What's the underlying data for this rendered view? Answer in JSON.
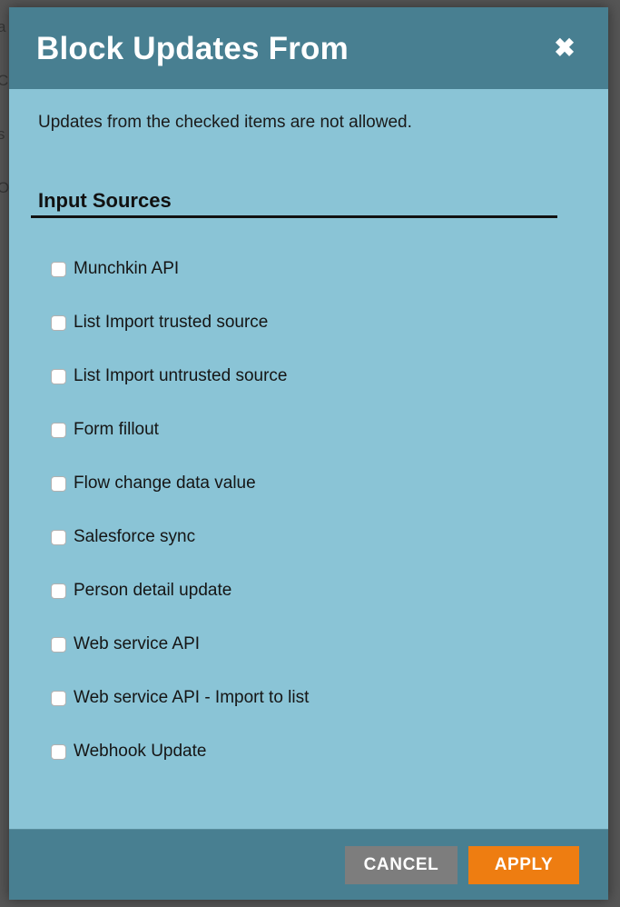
{
  "backdrop": {
    "clipped_glyphs": [
      "a",
      "C",
      "s",
      "O"
    ]
  },
  "dialog": {
    "title": "Block Updates From",
    "close_icon": "close-icon",
    "close_glyph": "✖",
    "description": "Updates from the checked items are not allowed.",
    "section_heading": "Input Sources",
    "items": [
      {
        "label": "Munchkin API",
        "checked": false
      },
      {
        "label": "List Import trusted source",
        "checked": false
      },
      {
        "label": "List Import untrusted source",
        "checked": false
      },
      {
        "label": "Form fillout",
        "checked": false
      },
      {
        "label": "Flow change data value",
        "checked": false
      },
      {
        "label": "Salesforce sync",
        "checked": false
      },
      {
        "label": "Person detail update",
        "checked": false
      },
      {
        "label": "Web service API",
        "checked": false
      },
      {
        "label": "Web service API - Import to list",
        "checked": false
      },
      {
        "label": "Webhook Update",
        "checked": false
      }
    ],
    "footer": {
      "cancel_label": "CANCEL",
      "apply_label": "APPLY"
    }
  },
  "colors": {
    "header_teal": "#487f91",
    "body_blue": "#8ac4d6",
    "apply_orange": "#ee7d11",
    "cancel_grey": "#7d7d7d",
    "backdrop_grey": "#565656",
    "text_dark": "#151515"
  }
}
